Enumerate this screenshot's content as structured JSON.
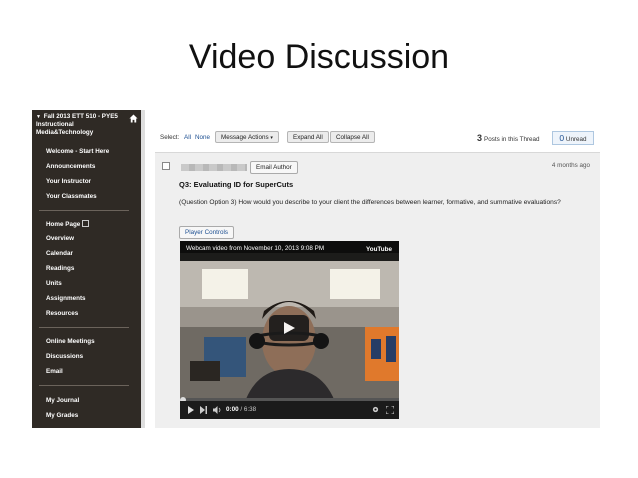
{
  "slide": {
    "title": "Video Discussion"
  },
  "sidebar": {
    "course_title": "Fall 2013 ETT 510 - PYE5 Instructional Media&Technology",
    "groups": [
      [
        "Welcome - Start Here",
        "Announcements",
        "Your Instructor",
        "Your Classmates"
      ],
      [
        "Home Page",
        "Overview",
        "Calendar",
        "Readings",
        "Units",
        "Assignments",
        "Resources"
      ],
      [
        "Online Meetings",
        "Discussions",
        "Email"
      ],
      [
        "My Journal",
        "My Grades"
      ]
    ]
  },
  "toolbar": {
    "select_label": "Select:",
    "select_all": "All",
    "select_none": "None",
    "message_actions": "Message Actions",
    "expand_all": "Expand All",
    "collapse_all": "Collapse All",
    "posts_count": "3",
    "posts_label": "Posts in this Thread",
    "unread_count": "0",
    "unread_label": "Unread"
  },
  "post": {
    "email_author": "Email Author",
    "time_ago": "4 months ago",
    "title": "Q3: Evaluating ID for SuperCuts",
    "body": "(Question Option 3) How would you describe to your client the differences between learner, formative, and summative evaluations?",
    "player_controls": "Player Controls"
  },
  "video": {
    "title": "Webcam video from November 10, 2013 9:08 PM",
    "brand": "YouTube",
    "current_time": "0:00",
    "duration": "6:38",
    "progress_fraction": 0
  },
  "icons": {
    "home": "home-icon",
    "external": "external-link-icon",
    "play": "play-icon",
    "volume": "volume-icon",
    "settings": "gear-icon",
    "fullscreen": "fullscreen-icon"
  },
  "colors": {
    "sidebar_bg": "#2f2a25",
    "link": "#1d4f91",
    "post_bg": "#efefef"
  }
}
